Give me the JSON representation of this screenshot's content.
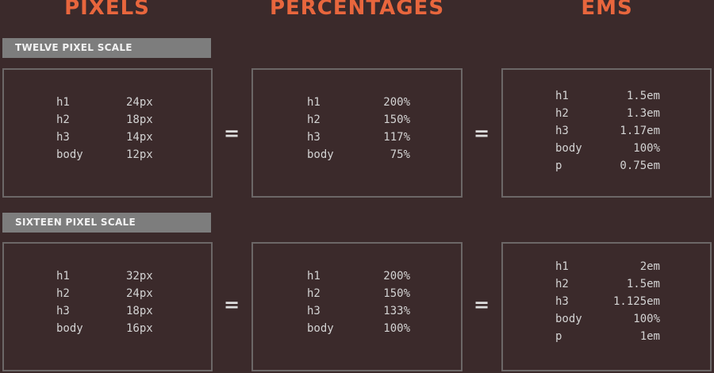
{
  "headers": {
    "pixels": "PIXELS",
    "percentages": "PERCENTAGES",
    "ems": "EMS"
  },
  "equals": "=",
  "sections": [
    {
      "label": "TWELVE PIXEL SCALE",
      "pixels": [
        {
          "tag": "h1",
          "value": "24px"
        },
        {
          "tag": "h2",
          "value": "18px"
        },
        {
          "tag": "h3",
          "value": "14px"
        },
        {
          "tag": "body",
          "value": "12px"
        }
      ],
      "percentages": [
        {
          "tag": "h1",
          "value": "200%"
        },
        {
          "tag": "h2",
          "value": "150%"
        },
        {
          "tag": "h3",
          "value": "117%"
        },
        {
          "tag": "body",
          "value": "75%"
        }
      ],
      "ems": [
        {
          "tag": "h1",
          "value": "1.5em"
        },
        {
          "tag": "h2",
          "value": "1.3em"
        },
        {
          "tag": "h3",
          "value": "1.17em"
        },
        {
          "tag": "body",
          "value": "100%"
        },
        {
          "tag": "p",
          "value": "0.75em"
        }
      ]
    },
    {
      "label": "SIXTEEN PIXEL SCALE",
      "pixels": [
        {
          "tag": "h1",
          "value": "32px"
        },
        {
          "tag": "h2",
          "value": "24px"
        },
        {
          "tag": "h3",
          "value": "18px"
        },
        {
          "tag": "body",
          "value": "16px"
        }
      ],
      "percentages": [
        {
          "tag": "h1",
          "value": "200%"
        },
        {
          "tag": "h2",
          "value": "150%"
        },
        {
          "tag": "h3",
          "value": "133%"
        },
        {
          "tag": "body",
          "value": "100%"
        }
      ],
      "ems": [
        {
          "tag": "h1",
          "value": "2em"
        },
        {
          "tag": "h2",
          "value": "1.5em"
        },
        {
          "tag": "h3",
          "value": "1.125em"
        },
        {
          "tag": "body",
          "value": "100%"
        },
        {
          "tag": "p",
          "value": "1em"
        }
      ]
    }
  ],
  "colors": {
    "background": "#3b2a2b",
    "header_accent": "#e8663d",
    "label_bar": "#7d7d7d",
    "box_border": "#6c6767",
    "text": "#d3d3d3"
  }
}
